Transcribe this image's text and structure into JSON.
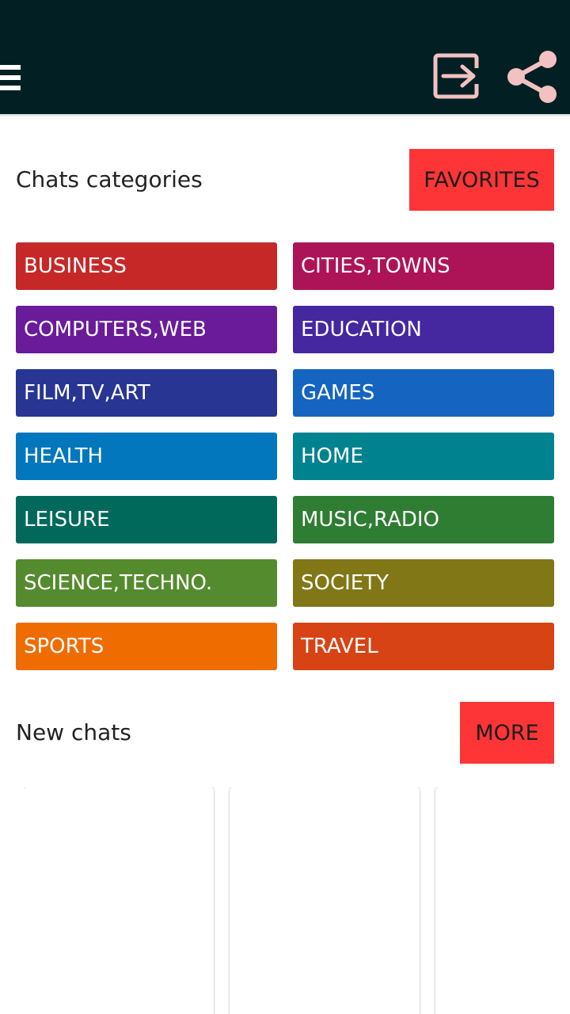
{
  "header": {
    "background": "#022023",
    "icons": {
      "menu": "menu-icon",
      "exit": "exit-icon",
      "share": "share-icon"
    }
  },
  "categories_section": {
    "title": "Chats categories",
    "favorites_label": "FAVORITES",
    "items": [
      {
        "label": "BUSINESS",
        "color": "#c62828"
      },
      {
        "label": "CITIES,TOWNS",
        "color": "#ad1457"
      },
      {
        "label": "COMPUTERS,WEB",
        "color": "#6a1b9a"
      },
      {
        "label": "EDUCATION",
        "color": "#4527a0"
      },
      {
        "label": "FILM,TV,ART",
        "color": "#283593"
      },
      {
        "label": "GAMES",
        "color": "#1565c0"
      },
      {
        "label": "HEALTH",
        "color": "#0277bd"
      },
      {
        "label": "HOME",
        "color": "#00838f"
      },
      {
        "label": "LEISURE",
        "color": "#00695c"
      },
      {
        "label": "MUSIC,RADIO",
        "color": "#2e7d32"
      },
      {
        "label": "SCIENCE,TECHNO.",
        "color": "#558b2f"
      },
      {
        "label": "SOCIETY",
        "color": "#827717"
      },
      {
        "label": "SPORTS",
        "color": "#ef6c00"
      },
      {
        "label": "TRAVEL",
        "color": "#d84315"
      }
    ]
  },
  "new_chats_section": {
    "title": "New chats",
    "more_label": "MORE",
    "cards_count": 3
  },
  "colors": {
    "accent_red": "#fd3537",
    "icon_pink": "#f3c1c1"
  }
}
